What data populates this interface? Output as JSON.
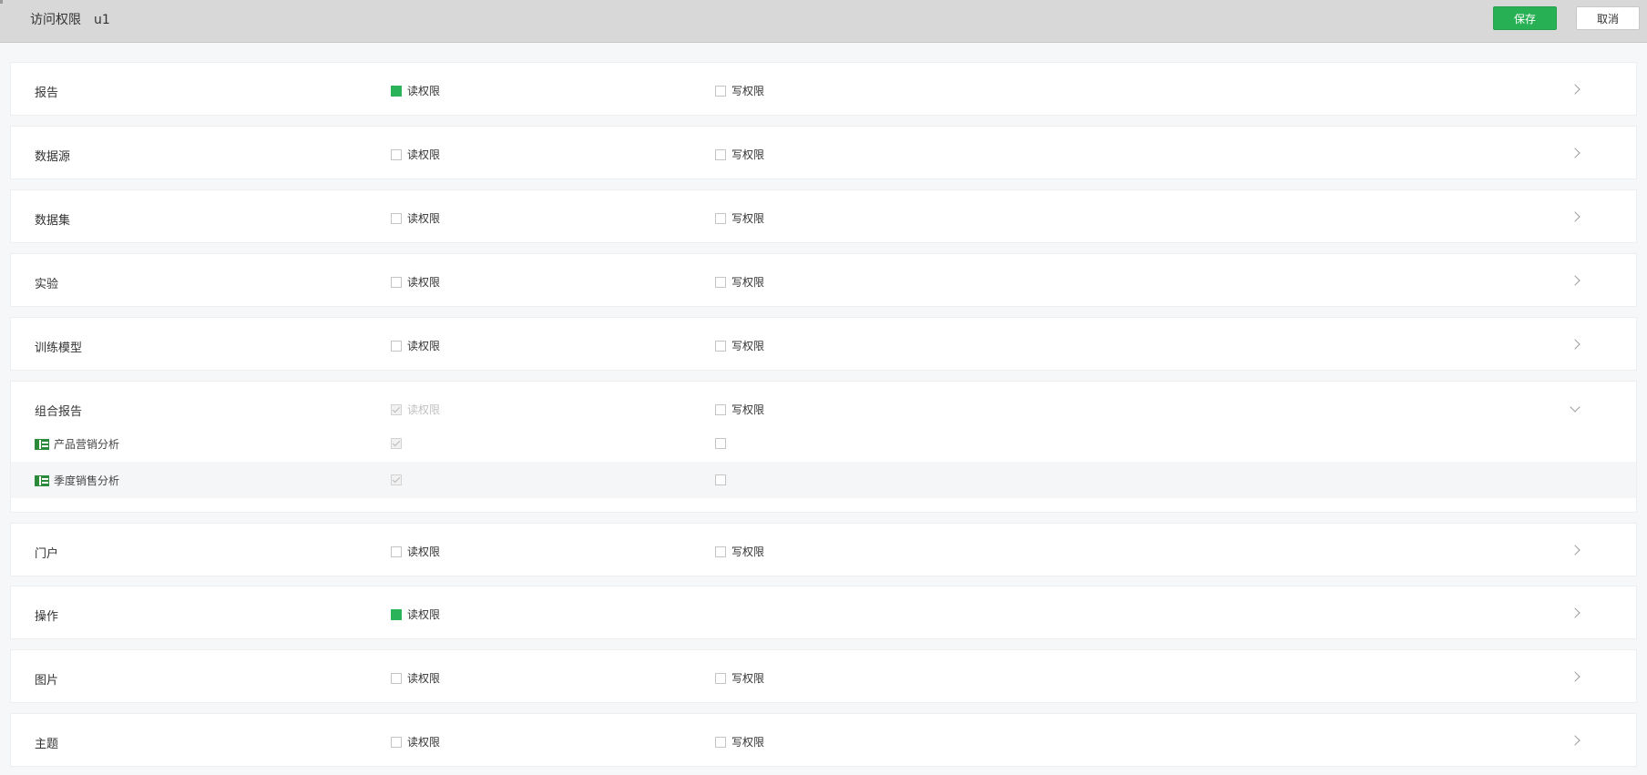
{
  "header": {
    "title": "访问权限",
    "user": "u1",
    "save_label": "保存",
    "cancel_label": "取消"
  },
  "colors": {
    "accent": "#28b055",
    "icon_green": "#2a8a3a"
  },
  "labels": {
    "read": "读权限",
    "write": "写权限"
  },
  "rows": [
    {
      "name": "报告",
      "read": "checked",
      "write": "unchecked",
      "expanded": false
    },
    {
      "name": "数据源",
      "read": "unchecked",
      "write": "unchecked",
      "expanded": false
    },
    {
      "name": "数据集",
      "read": "unchecked",
      "write": "unchecked",
      "expanded": false
    },
    {
      "name": "实验",
      "read": "unchecked",
      "write": "unchecked",
      "expanded": false
    },
    {
      "name": "训练模型",
      "read": "unchecked",
      "write": "unchecked",
      "expanded": false
    },
    {
      "name": "组合报告",
      "read": "disabled-checked",
      "write": "unchecked",
      "expanded": true,
      "children": [
        {
          "name": "产品营销分析",
          "read": "disabled-checked",
          "write": "unchecked",
          "icon": "dashboard-grid-icon"
        },
        {
          "name": "季度销售分析",
          "read": "disabled-checked",
          "write": "unchecked",
          "icon": "dashboard-grid-icon"
        }
      ]
    },
    {
      "name": "门户",
      "read": "unchecked",
      "write": "unchecked",
      "expanded": false
    },
    {
      "name": "操作",
      "read": "checked",
      "write": null,
      "expanded": false
    },
    {
      "name": "图片",
      "read": "unchecked",
      "write": "unchecked",
      "expanded": false
    },
    {
      "name": "主题",
      "read": "unchecked",
      "write": "unchecked",
      "expanded": false
    }
  ]
}
